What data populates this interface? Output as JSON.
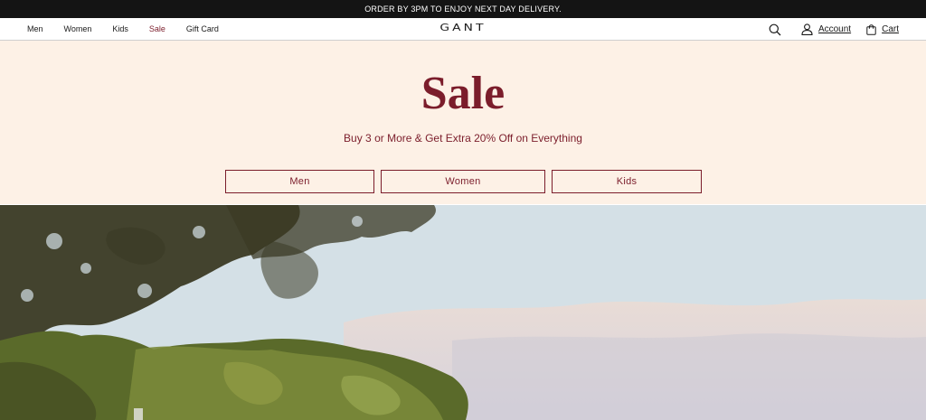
{
  "promo": {
    "text": "ORDER BY 3PM TO ENJOY NEXT DAY DELIVERY."
  },
  "header": {
    "nav": [
      {
        "label": "Men"
      },
      {
        "label": "Women"
      },
      {
        "label": "Kids"
      },
      {
        "label": "Sale",
        "active": true
      },
      {
        "label": "Gift Card"
      }
    ],
    "logo": "GANT",
    "account_label": "Account",
    "cart_label": "Cart",
    "icons": [
      "search-icon",
      "user-icon",
      "bag-icon"
    ]
  },
  "hero": {
    "title": "Sale",
    "subtitle": "Buy 3 or More & Get Extra 20% Off on Everything",
    "categories": [
      {
        "label": "Men"
      },
      {
        "label": "Women"
      },
      {
        "label": "Kids"
      }
    ]
  },
  "colors": {
    "brand_burgundy": "#7b1d2b",
    "hero_background": "#fdf1e6",
    "promo_background": "#141414"
  }
}
